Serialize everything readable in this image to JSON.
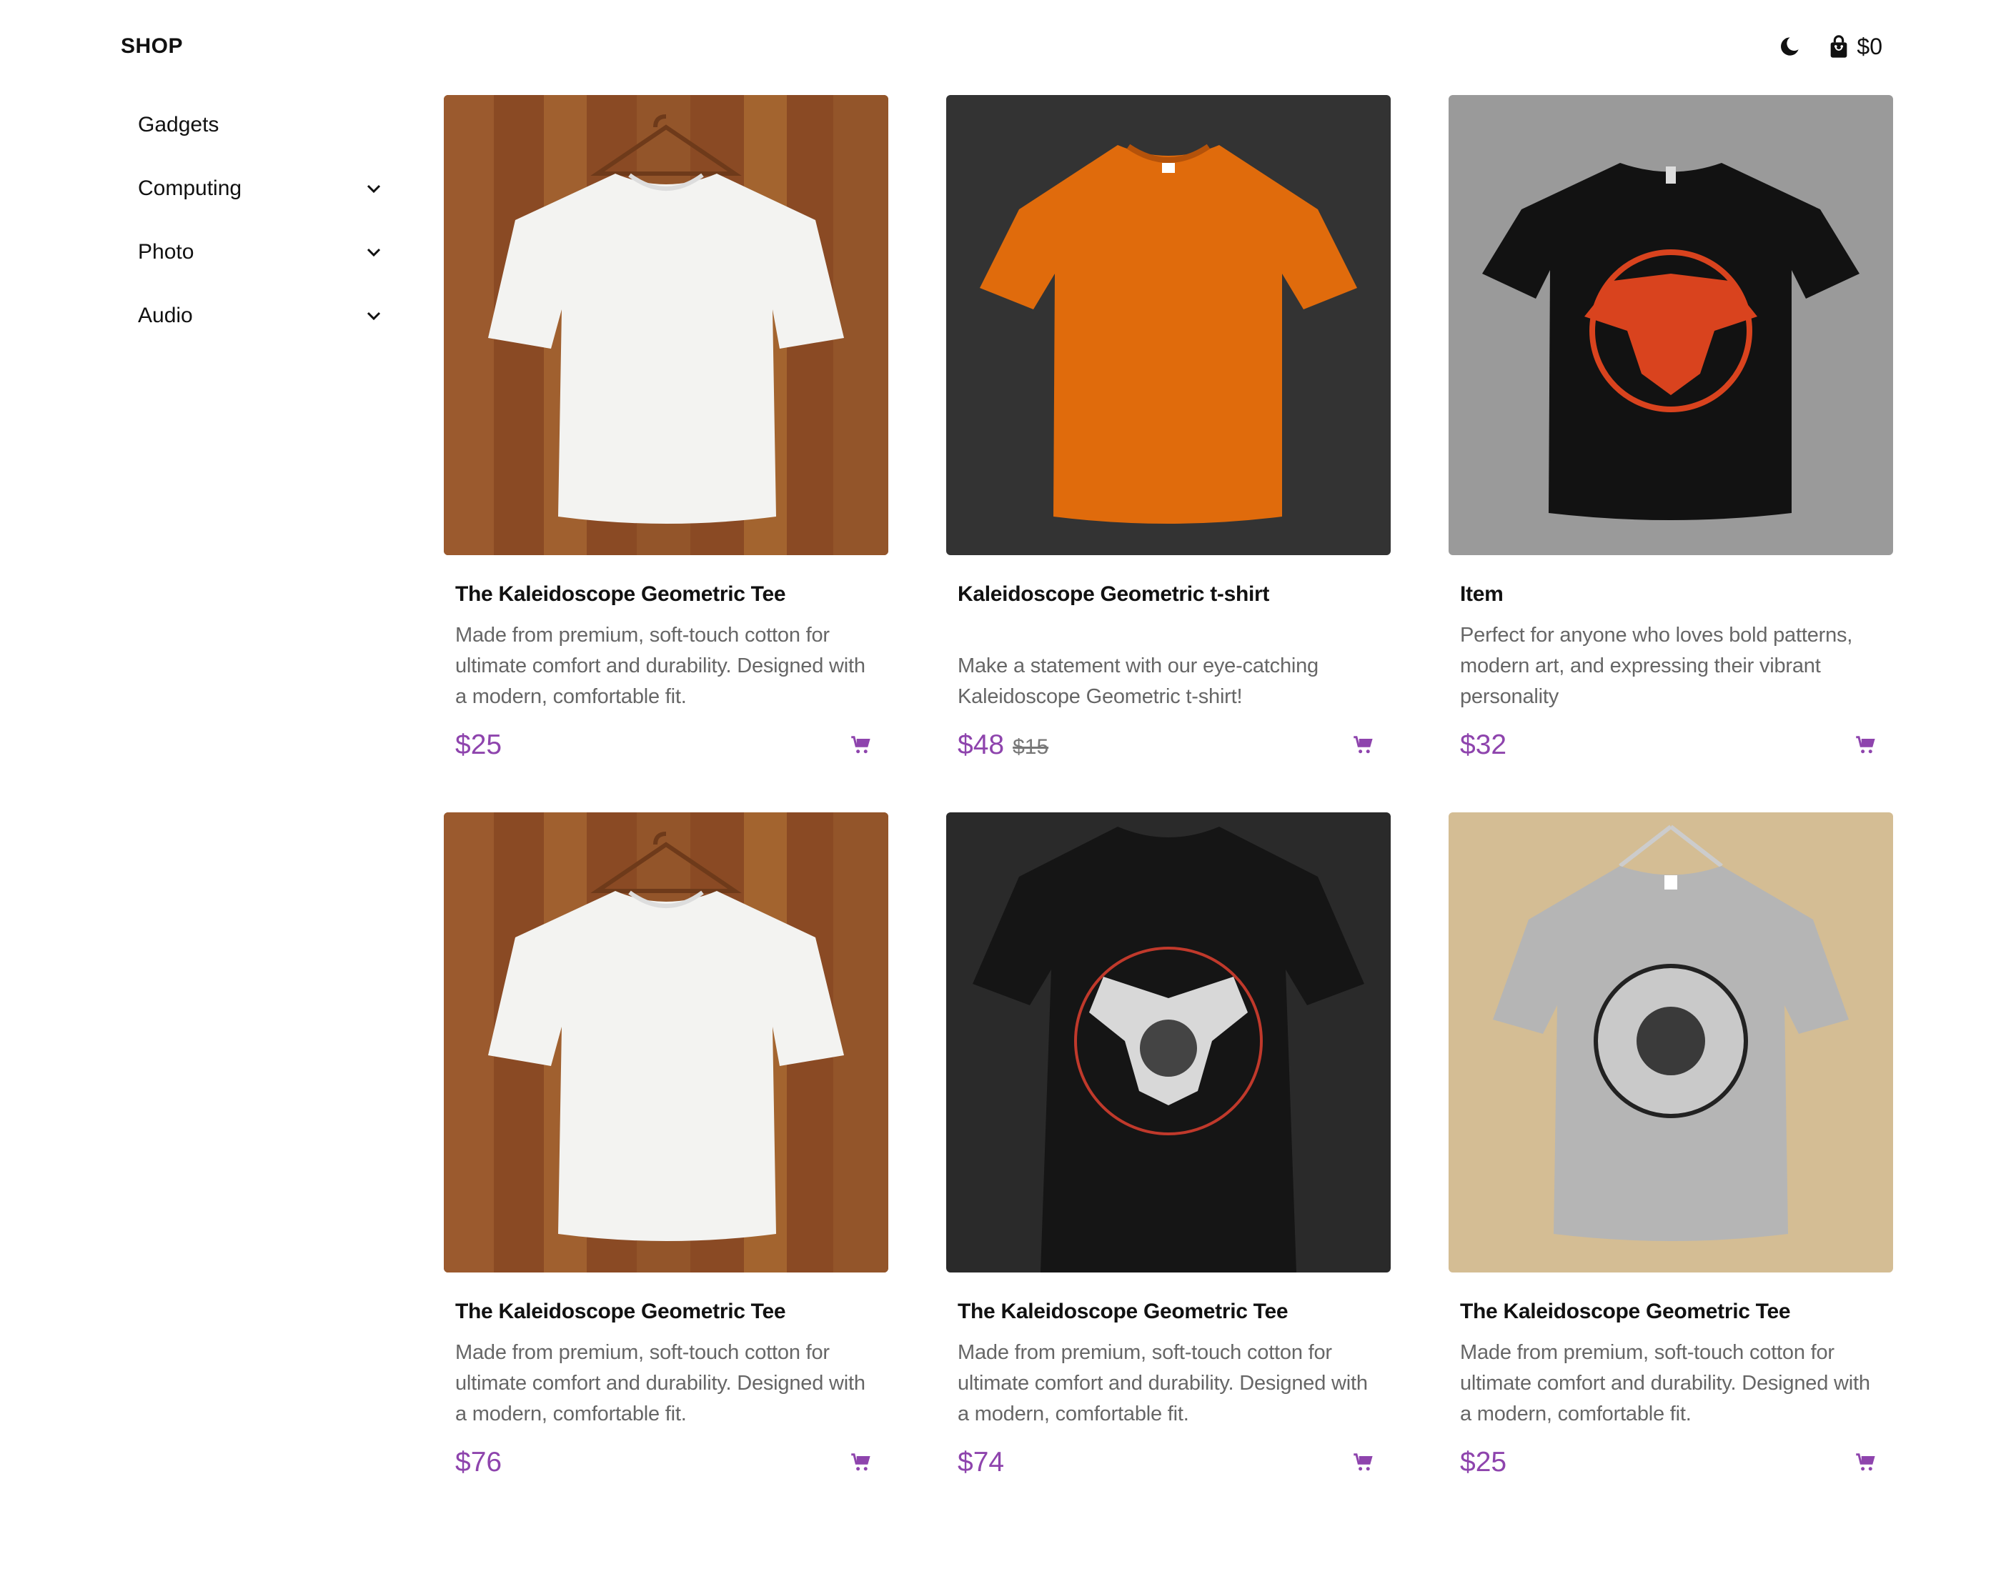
{
  "header": {
    "logo": "SHOP",
    "theme_icon": "moon-icon",
    "cart_icon": "shopping-bag-icon",
    "cart_total": "$0"
  },
  "sidebar": {
    "items": [
      {
        "label": "Gadgets",
        "has_children": false
      },
      {
        "label": "Computing",
        "has_children": true
      },
      {
        "label": "Photo",
        "has_children": true
      },
      {
        "label": "Audio",
        "has_children": true
      }
    ]
  },
  "colors": {
    "price": "#8e44ad",
    "text": "#111111",
    "muted": "#666666"
  },
  "products": [
    {
      "title": "The Kaleidoscope Geometric Tee",
      "description": "Made from premium, soft-touch cotton for ultimate comfort and durability. Designed with a modern, comfortable fit.",
      "price": "$25",
      "old_price": "",
      "image": "white t-shirt on wooden wall"
    },
    {
      "title": "Kaleidoscope Geometric t-shirt",
      "description": "Make a statement with our eye-catching Kaleidoscope Geometric t-shirt!",
      "price": "$48",
      "old_price": "$15",
      "image": "orange t-shirt on dark background"
    },
    {
      "title": "Item",
      "description": "Perfect for anyone who loves bold patterns, modern art, and expressing their vibrant personality",
      "price": "$32",
      "old_price": "",
      "image": "black t-shirt with red eagle emblem"
    },
    {
      "title": "The Kaleidoscope Geometric Tee",
      "description": "Made from premium, soft-touch cotton for ultimate comfort and durability. Designed with a modern, comfortable fit.",
      "price": "$76",
      "old_price": "",
      "image": "white t-shirt on wooden wall"
    },
    {
      "title": "The Kaleidoscope Geometric Tee",
      "description": "Made from premium, soft-touch cotton for ultimate comfort and durability. Designed with a modern, comfortable fit.",
      "price": "$74",
      "old_price": "",
      "image": "black t-shirt with winged emblem"
    },
    {
      "title": "The Kaleidoscope Geometric Tee",
      "description": "Made from premium, soft-touch cotton for ultimate comfort and durability. Designed with a modern, comfortable fit.",
      "price": "$25",
      "old_price": "",
      "image": "grey t-shirt with portrait badge"
    }
  ]
}
